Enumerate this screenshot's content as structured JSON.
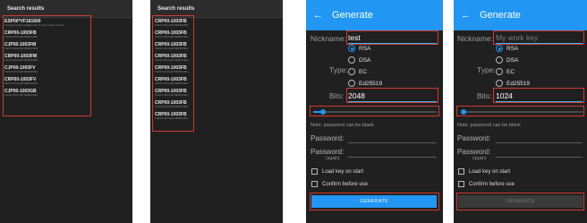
{
  "search_panels": [
    {
      "header": "Search results",
      "items": [
        {
          "title": "ESP00*VF181600",
          "sub": "Improved contact reliability with a 3-point contact structure"
        },
        {
          "title": "CRP00-1003FB",
          "sub": "THICK FILM CHIP RESISTORS"
        },
        {
          "title": "CJP00-1003FM",
          "sub": "THICK FILM CHIP RESISTORS"
        },
        {
          "title": "CRP00-1003FM",
          "sub": "THICK FILM CHIP RESISTORS"
        },
        {
          "title": "CJP00-1003FV",
          "sub": "THICK FILM CHIP RESISTORS"
        },
        {
          "title": "CRP00-1003FV",
          "sub": "THICK FILM CHIP RESISTORS"
        },
        {
          "title": "CJP00-1003GB",
          "sub": "THICK FILM CHIP RESISTORS"
        }
      ]
    },
    {
      "header": "Search results",
      "items": [
        {
          "title": "CRP00-1003FB",
          "sub": "THICK FILM CHIP RESISTORS"
        },
        {
          "title": "CRP00-1003FB",
          "sub": "THICK FILM CHIP RESISTORS"
        },
        {
          "title": "CRP00-1003FB",
          "sub": "THICK FILM CHIP RESISTORS"
        },
        {
          "title": "CRP00-1003FB",
          "sub": "THICK FILM CHIP RESISTORS"
        },
        {
          "title": "CRP00-1003FB",
          "sub": "THICK FILM CHIP RESISTORS"
        },
        {
          "title": "CRP00-1003FB",
          "sub": "THICK FILM CHIP RESISTORS"
        },
        {
          "title": "CRP00-1003FB",
          "sub": "THICK FILM CHIP RESISTORS"
        },
        {
          "title": "CRP00-1003FB",
          "sub": "THICK FILM CHIP RESISTORS"
        },
        {
          "title": "CRP00-1003FB",
          "sub": "THICK FILM CHIP RESISTORS"
        }
      ]
    }
  ],
  "generate_panels": [
    {
      "title": "Generate",
      "back_icon": "←",
      "nickname_label": "Nickname:",
      "nickname_value": "test",
      "nickname_placeholder": "",
      "type_label": "Type:",
      "types": [
        "RSA",
        "DSA",
        "EC",
        "Ed25519"
      ],
      "selected_type": "RSA",
      "bits_label": "Bits:",
      "bits_value": "2048",
      "bits_slider_fraction": 0.08,
      "note": "Note: password can be blank",
      "password_label": "Password:",
      "password_again_label": "Password:",
      "password_again_sub": "(again)",
      "load_on_start": "Load key on start",
      "confirm_before_use": "Confirm before use",
      "generate_button": "GENERATE",
      "generate_enabled": true
    },
    {
      "title": "Generate",
      "back_icon": "←",
      "nickname_label": "Nickname:",
      "nickname_value": "",
      "nickname_placeholder": "My work key",
      "type_label": "Type:",
      "types": [
        "RSA",
        "DSA",
        "EC",
        "Ed25519"
      ],
      "selected_type": "RSA",
      "bits_label": "Bits:",
      "bits_value": "1024",
      "bits_slider_fraction": 0.0,
      "note": "Note: password can be blank",
      "password_label": "Password:",
      "password_again_label": "Password:",
      "password_again_sub": "(again)",
      "load_on_start": "Load key on start",
      "confirm_before_use": "Confirm before use",
      "generate_button": "GENERATE",
      "generate_enabled": false
    }
  ],
  "colors": {
    "accent": "#2196f3",
    "highlight_box": "#d13a2e",
    "background": "#202020"
  }
}
